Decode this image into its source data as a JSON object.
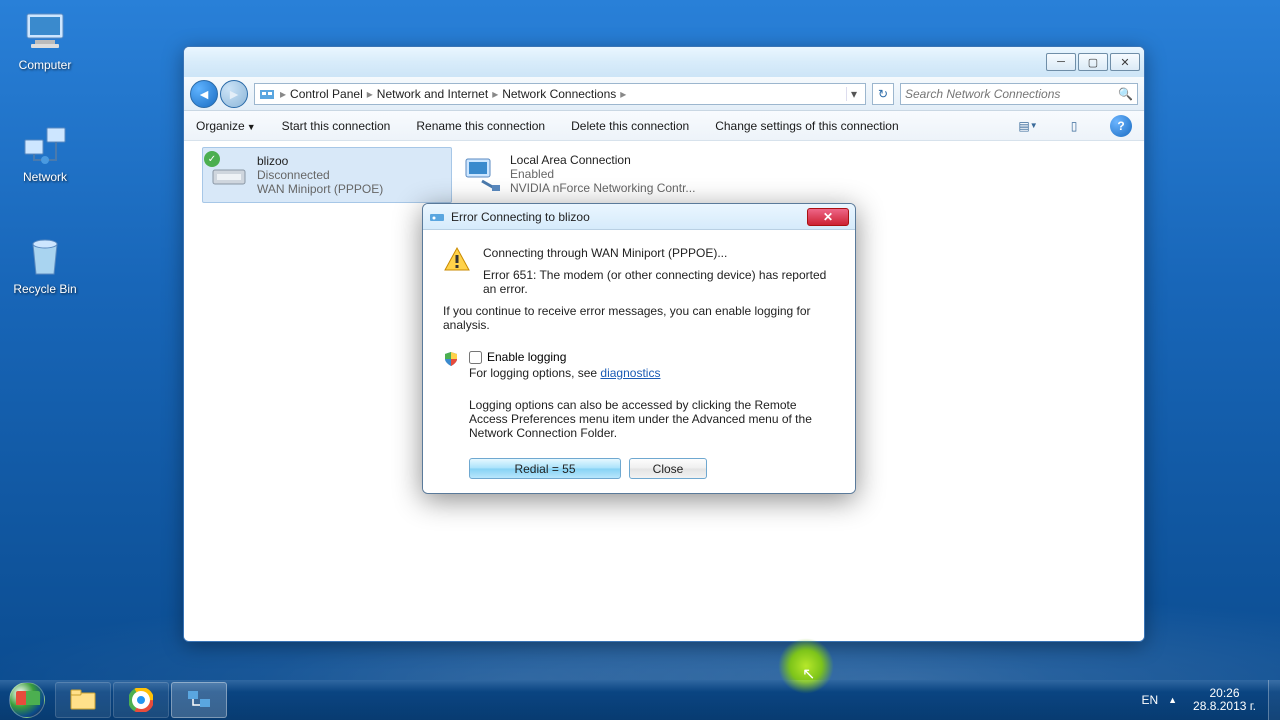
{
  "desktop": {
    "computer": "Computer",
    "network": "Network",
    "recycle": "Recycle Bin"
  },
  "window": {
    "breadcrumb": {
      "root_icon": "network-folder",
      "cp": "Control Panel",
      "ni": "Network and Internet",
      "nc": "Network Connections"
    },
    "search_placeholder": "Search Network Connections",
    "toolbar": {
      "organize": "Organize",
      "start": "Start this connection",
      "rename": "Rename this connection",
      "delete": "Delete this connection",
      "change": "Change settings of this connection"
    },
    "connections": [
      {
        "name": "blizoo",
        "status": "Disconnected",
        "device": "WAN Miniport (PPPOE)"
      },
      {
        "name": "Local Area Connection",
        "status": "Enabled",
        "device": "NVIDIA nForce Networking Contr..."
      }
    ]
  },
  "dialog": {
    "title": "Error Connecting to blizoo",
    "connecting_line": "Connecting through WAN Miniport (PPPOE)...",
    "error_line": "Error 651: The modem (or other connecting device) has reported an error.",
    "continue_line": "If you continue to receive error messages, you can enable logging for analysis.",
    "enable_logging_label": "Enable logging",
    "diag_prefix": "For logging options, see ",
    "diag_link": "diagnostics",
    "para": "Logging options can also be accessed by clicking the Remote Access Preferences menu item under the Advanced menu of the Network Connection Folder.",
    "redial_btn": "Redial = 55",
    "close_btn": "Close"
  },
  "taskbar": {
    "lang": "EN",
    "time": "20:26",
    "date": "28.8.2013 г."
  }
}
